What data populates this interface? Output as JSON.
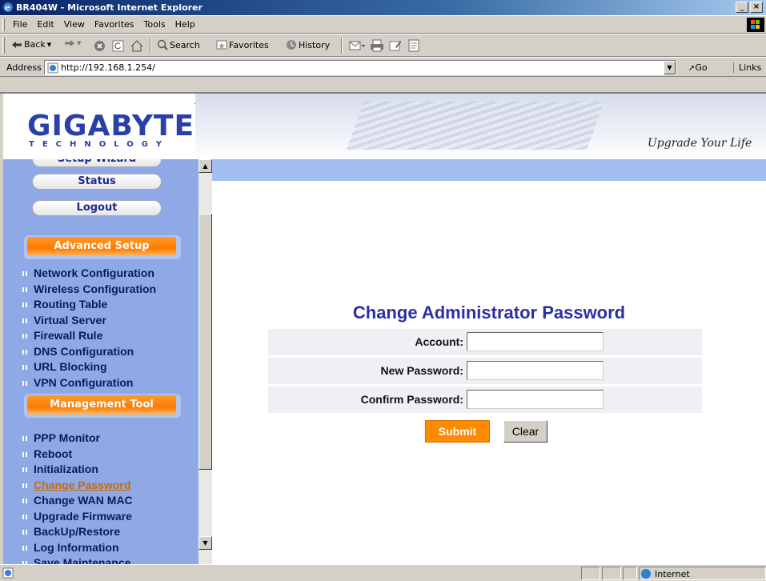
{
  "window": {
    "title": "BR404W - Microsoft Internet Explorer",
    "controls": [
      "_",
      "×"
    ]
  },
  "menubar": [
    "File",
    "Edit",
    "View",
    "Favorites",
    "Tools",
    "Help"
  ],
  "toolbar": {
    "back": "Back",
    "search": "Search",
    "favorites": "Favorites",
    "history": "History"
  },
  "addressbar": {
    "label": "Address",
    "url": "http://192.168.1.254/",
    "go": "Go",
    "links": "Links"
  },
  "banner": {
    "logo": "GIGABYTE",
    "logo_tm": "TM",
    "logo_sub": "TECHNOLOGY",
    "slogan": "Upgrade Your Life"
  },
  "sidebar": {
    "buttons": [
      "Setup Wizard",
      "Status",
      "Logout"
    ],
    "advanced_header": "Advanced Setup",
    "advanced_items": [
      "Network Configuration",
      "Wireless Configuration",
      "Routing Table",
      "Virtual Server",
      "Firewall Rule",
      "DNS Configuration",
      "URL Blocking",
      "VPN Configuration"
    ],
    "management_header": "Management Tool",
    "management_items": [
      "PPP Monitor",
      "Reboot",
      "Initialization",
      "Change Password",
      "Change WAN MAC",
      "Upgrade Firmware",
      "BackUp/Restore",
      "Log Information",
      "Save Maintenance"
    ],
    "active_item": "Change Password"
  },
  "form": {
    "title": "Change Administrator Password",
    "fields": [
      {
        "label": "Account:",
        "value": ""
      },
      {
        "label": "New Password:",
        "value": ""
      },
      {
        "label": "Confirm Password:",
        "value": ""
      }
    ],
    "submit": "Submit",
    "clear": "Clear"
  },
  "statusbar": {
    "zone": "Internet"
  },
  "colors": {
    "accent": "#ff8a00",
    "sidebar_bg": "#8fa8e6",
    "title_blue": "#2b2fa6",
    "nav_text": "#0b1a63"
  }
}
